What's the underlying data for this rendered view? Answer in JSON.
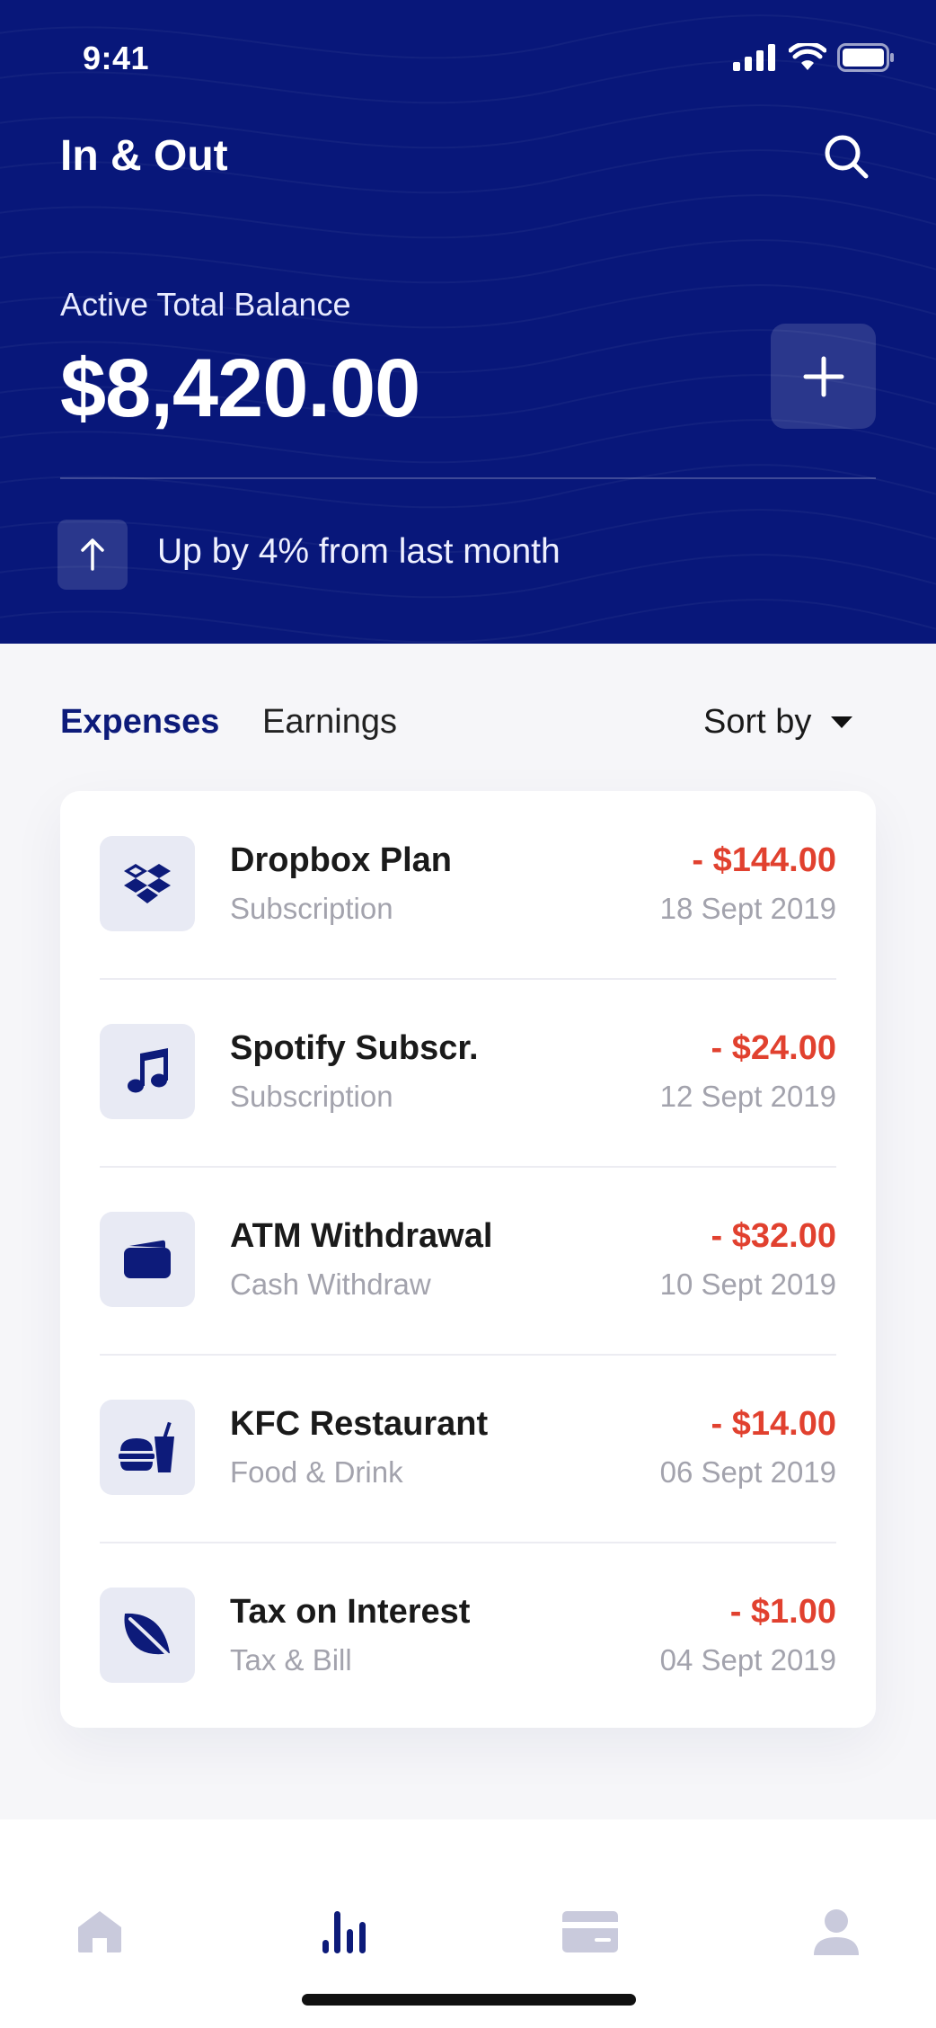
{
  "status_bar": {
    "time": "9:41"
  },
  "header": {
    "title": "In & Out",
    "balance_label": "Active Total Balance",
    "balance_value": "$8,420.00",
    "trend_text": "Up by 4% from last month"
  },
  "tabs": {
    "expenses": "Expenses",
    "earnings": "Earnings",
    "active": "Expenses",
    "sort_label": "Sort by"
  },
  "transactions": [
    {
      "title": "Dropbox Plan",
      "category": "Subscription",
      "amount": "- $144.00",
      "date": "18 Sept 2019",
      "icon": "dropbox-icon"
    },
    {
      "title": "Spotify Subscr.",
      "category": "Subscription",
      "amount": "- $24.00",
      "date": "12 Sept 2019",
      "icon": "music-note-icon"
    },
    {
      "title": "ATM Withdrawal",
      "category": "Cash Withdraw",
      "amount": "- $32.00",
      "date": "10 Sept 2019",
      "icon": "wallet-icon"
    },
    {
      "title": "KFC Restaurant",
      "category": "Food & Drink",
      "amount": "- $14.00",
      "date": "06 Sept 2019",
      "icon": "burger-drink-icon"
    },
    {
      "title": "Tax on Interest",
      "category": "Tax & Bill",
      "amount": "- $1.00",
      "date": "04 Sept 2019",
      "icon": "leaf-icon"
    }
  ],
  "bottom_nav": {
    "items": [
      {
        "icon": "home-icon",
        "active": false
      },
      {
        "icon": "stats-icon",
        "active": true
      },
      {
        "icon": "card-icon",
        "active": false
      },
      {
        "icon": "profile-icon",
        "active": false
      }
    ]
  },
  "colors": {
    "brand_blue": "#08177a",
    "expense_red": "#e1412f",
    "icon_bg": "#e8eaf4",
    "nav_inactive": "#c9cadc"
  }
}
